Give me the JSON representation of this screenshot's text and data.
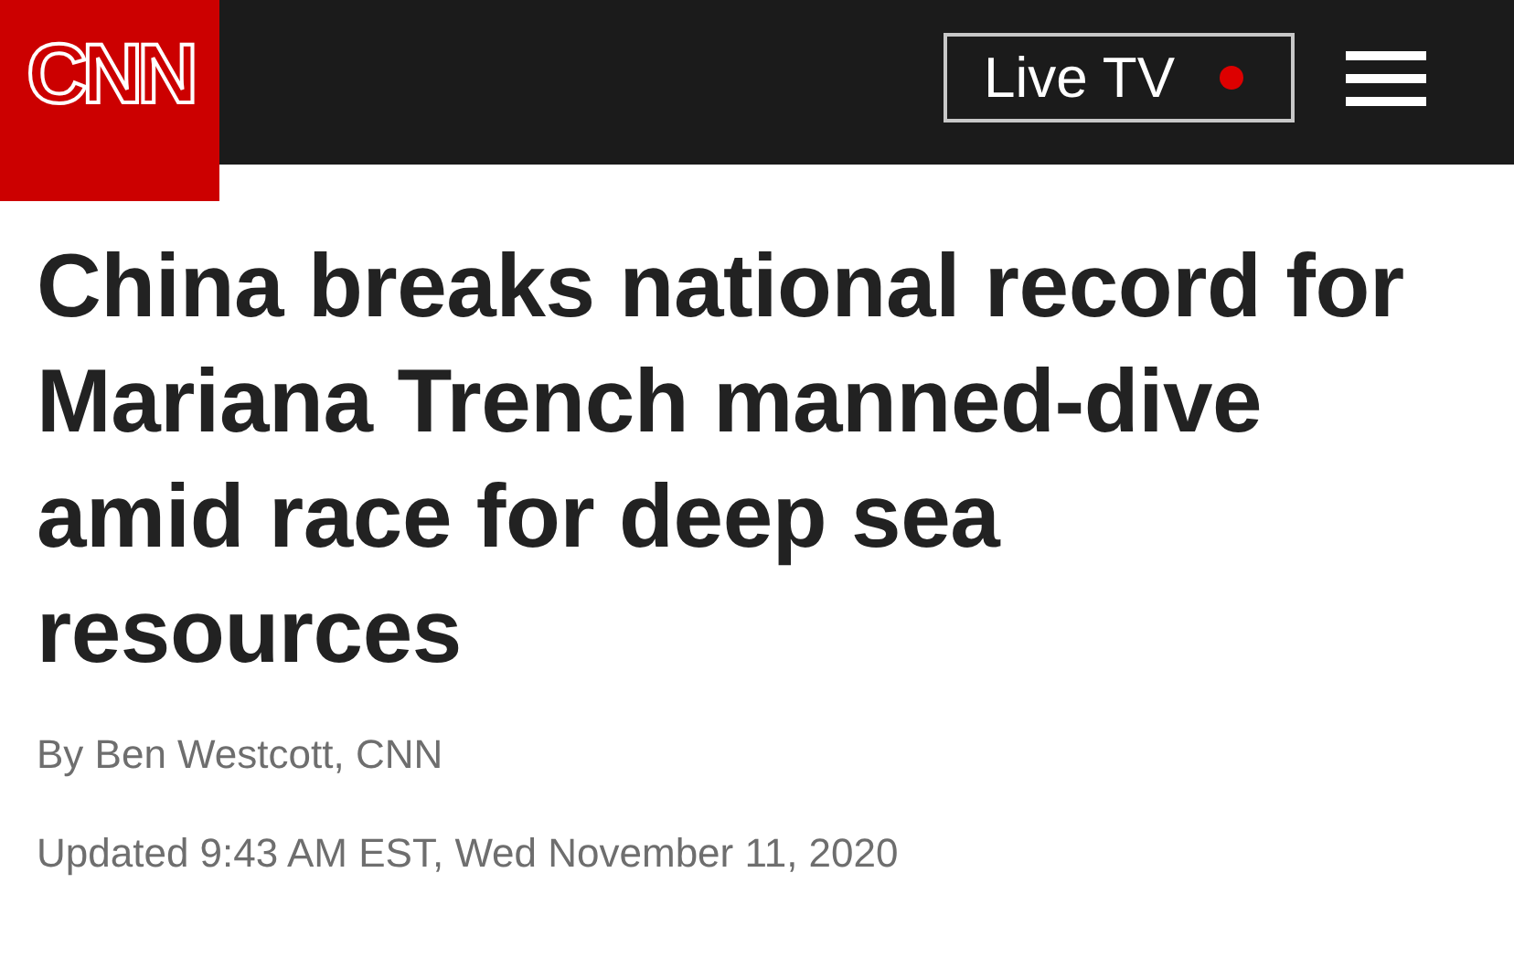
{
  "header": {
    "logo": "CNN",
    "live_tv_button": "Live TV"
  },
  "article": {
    "headline": "China breaks national record for Mariana Trench manned-dive amid race for deep sea resources",
    "byline": "By Ben Westcott, CNN",
    "updated": "Updated 9:43 AM EST, Wed November 11, 2020"
  }
}
